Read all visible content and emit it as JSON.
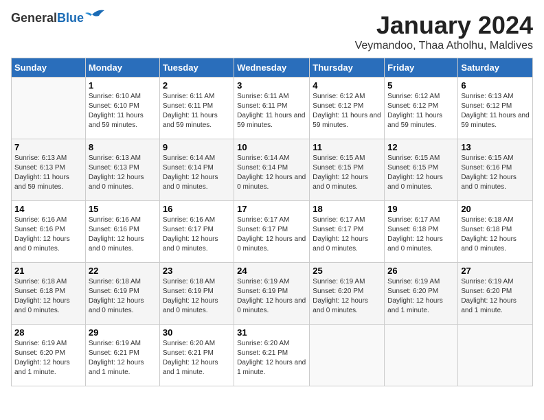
{
  "logo": {
    "general": "General",
    "blue": "Blue"
  },
  "header": {
    "month_title": "January 2024",
    "location": "Veymandoo, Thaa Atholhu, Maldives"
  },
  "days_of_week": [
    "Sunday",
    "Monday",
    "Tuesday",
    "Wednesday",
    "Thursday",
    "Friday",
    "Saturday"
  ],
  "weeks": [
    [
      {
        "day": "",
        "empty": true
      },
      {
        "day": "1",
        "sunrise": "6:10 AM",
        "sunset": "6:10 PM",
        "daylight": "11 hours and 59 minutes."
      },
      {
        "day": "2",
        "sunrise": "6:11 AM",
        "sunset": "6:11 PM",
        "daylight": "11 hours and 59 minutes."
      },
      {
        "day": "3",
        "sunrise": "6:11 AM",
        "sunset": "6:11 PM",
        "daylight": "11 hours and 59 minutes."
      },
      {
        "day": "4",
        "sunrise": "6:12 AM",
        "sunset": "6:12 PM",
        "daylight": "11 hours and 59 minutes."
      },
      {
        "day": "5",
        "sunrise": "6:12 AM",
        "sunset": "6:12 PM",
        "daylight": "11 hours and 59 minutes."
      },
      {
        "day": "6",
        "sunrise": "6:13 AM",
        "sunset": "6:12 PM",
        "daylight": "11 hours and 59 minutes."
      }
    ],
    [
      {
        "day": "7",
        "sunrise": "6:13 AM",
        "sunset": "6:13 PM",
        "daylight": "11 hours and 59 minutes."
      },
      {
        "day": "8",
        "sunrise": "6:13 AM",
        "sunset": "6:13 PM",
        "daylight": "12 hours and 0 minutes."
      },
      {
        "day": "9",
        "sunrise": "6:14 AM",
        "sunset": "6:14 PM",
        "daylight": "12 hours and 0 minutes."
      },
      {
        "day": "10",
        "sunrise": "6:14 AM",
        "sunset": "6:14 PM",
        "daylight": "12 hours and 0 minutes."
      },
      {
        "day": "11",
        "sunrise": "6:15 AM",
        "sunset": "6:15 PM",
        "daylight": "12 hours and 0 minutes."
      },
      {
        "day": "12",
        "sunrise": "6:15 AM",
        "sunset": "6:15 PM",
        "daylight": "12 hours and 0 minutes."
      },
      {
        "day": "13",
        "sunrise": "6:15 AM",
        "sunset": "6:16 PM",
        "daylight": "12 hours and 0 minutes."
      }
    ],
    [
      {
        "day": "14",
        "sunrise": "6:16 AM",
        "sunset": "6:16 PM",
        "daylight": "12 hours and 0 minutes."
      },
      {
        "day": "15",
        "sunrise": "6:16 AM",
        "sunset": "6:16 PM",
        "daylight": "12 hours and 0 minutes."
      },
      {
        "day": "16",
        "sunrise": "6:16 AM",
        "sunset": "6:17 PM",
        "daylight": "12 hours and 0 minutes."
      },
      {
        "day": "17",
        "sunrise": "6:17 AM",
        "sunset": "6:17 PM",
        "daylight": "12 hours and 0 minutes."
      },
      {
        "day": "18",
        "sunrise": "6:17 AM",
        "sunset": "6:17 PM",
        "daylight": "12 hours and 0 minutes."
      },
      {
        "day": "19",
        "sunrise": "6:17 AM",
        "sunset": "6:18 PM",
        "daylight": "12 hours and 0 minutes."
      },
      {
        "day": "20",
        "sunrise": "6:18 AM",
        "sunset": "6:18 PM",
        "daylight": "12 hours and 0 minutes."
      }
    ],
    [
      {
        "day": "21",
        "sunrise": "6:18 AM",
        "sunset": "6:18 PM",
        "daylight": "12 hours and 0 minutes."
      },
      {
        "day": "22",
        "sunrise": "6:18 AM",
        "sunset": "6:19 PM",
        "daylight": "12 hours and 0 minutes."
      },
      {
        "day": "23",
        "sunrise": "6:18 AM",
        "sunset": "6:19 PM",
        "daylight": "12 hours and 0 minutes."
      },
      {
        "day": "24",
        "sunrise": "6:19 AM",
        "sunset": "6:19 PM",
        "daylight": "12 hours and 0 minutes."
      },
      {
        "day": "25",
        "sunrise": "6:19 AM",
        "sunset": "6:20 PM",
        "daylight": "12 hours and 0 minutes."
      },
      {
        "day": "26",
        "sunrise": "6:19 AM",
        "sunset": "6:20 PM",
        "daylight": "12 hours and 1 minute."
      },
      {
        "day": "27",
        "sunrise": "6:19 AM",
        "sunset": "6:20 PM",
        "daylight": "12 hours and 1 minute."
      }
    ],
    [
      {
        "day": "28",
        "sunrise": "6:19 AM",
        "sunset": "6:20 PM",
        "daylight": "12 hours and 1 minute."
      },
      {
        "day": "29",
        "sunrise": "6:19 AM",
        "sunset": "6:21 PM",
        "daylight": "12 hours and 1 minute."
      },
      {
        "day": "30",
        "sunrise": "6:20 AM",
        "sunset": "6:21 PM",
        "daylight": "12 hours and 1 minute."
      },
      {
        "day": "31",
        "sunrise": "6:20 AM",
        "sunset": "6:21 PM",
        "daylight": "12 hours and 1 minute."
      },
      {
        "day": "",
        "empty": true
      },
      {
        "day": "",
        "empty": true
      },
      {
        "day": "",
        "empty": true
      }
    ]
  ]
}
